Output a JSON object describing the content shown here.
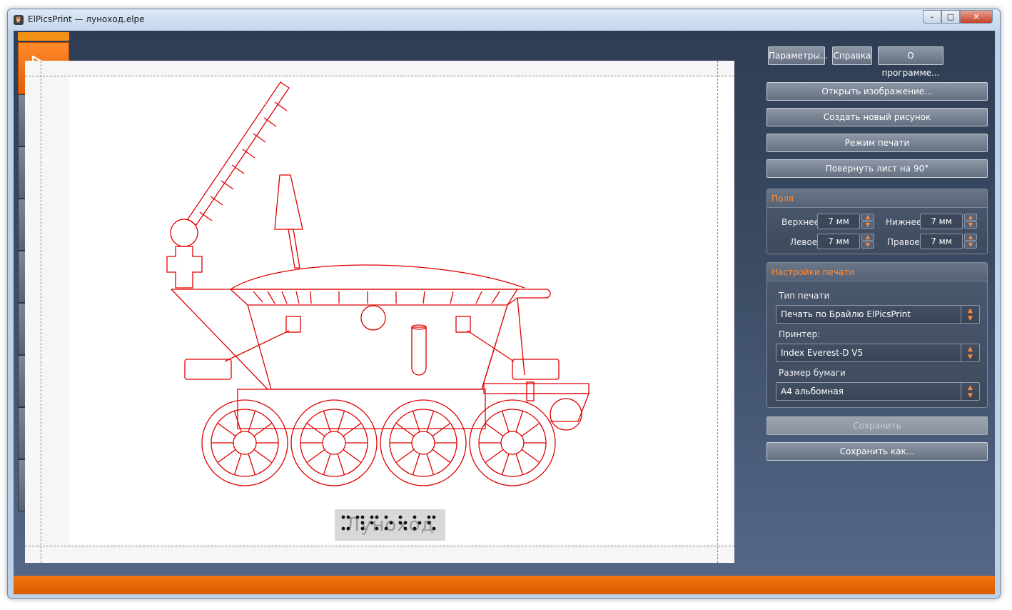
{
  "window": {
    "title": "ElPicsPrint — луноход.elpe",
    "app_icon": "owl-icon",
    "controls": {
      "minimize": "–",
      "maximize": "□",
      "close": "✕"
    }
  },
  "toolbar": {
    "tools": [
      {
        "name": "select",
        "icon": "cursor-arrow-icon",
        "active": true
      },
      {
        "name": "pencil",
        "icon": "pencil-icon",
        "active": false
      },
      {
        "name": "triangle",
        "icon": "triangle-icon",
        "active": false
      },
      {
        "name": "rectangle",
        "icon": "rectangle-icon",
        "active": false
      },
      {
        "name": "ellipse",
        "icon": "ellipse-icon",
        "active": false
      },
      {
        "name": "image",
        "icon": "image-icon",
        "active": false
      },
      {
        "name": "magic",
        "icon": "magic-wand-icon",
        "active": false
      },
      {
        "name": "text",
        "icon": "text-icon",
        "active": false
      },
      {
        "name": "eraser",
        "icon": "eraser-icon",
        "active": false
      }
    ]
  },
  "canvas": {
    "caption": "Луноход",
    "drawing_color": "#e00000"
  },
  "panel": {
    "top_buttons": {
      "settings": "Параметры...",
      "help": "Справка",
      "about": "О программе..."
    },
    "actions": {
      "open": "Открыть изображение...",
      "new": "Создать новый рисунок",
      "print_mode": "Режим печати",
      "rotate": "Повернуть лист на 90°"
    },
    "margins": {
      "header": "Поля",
      "top_label": "Верхнее",
      "top_value": "7 мм",
      "bottom_label": "Нижнее",
      "bottom_value": "7 мм",
      "left_label": "Левое",
      "left_value": "7 мм",
      "right_label": "Правое",
      "right_value": "7 мм"
    },
    "print_settings": {
      "header": "Настройки печати",
      "type_label": "Тип печати",
      "type_value": "Печать по Брайлю ElPicsPrint",
      "printer_label": "Принтер:",
      "printer_value": "Index Everest-D V5",
      "paper_label": "Размер бумаги",
      "paper_value": "А4 альбомная"
    },
    "save": "Сохранить",
    "save_as": "Сохранить как..."
  },
  "colors": {
    "accent": "#f0740e",
    "highlight": "#ff8a36"
  }
}
